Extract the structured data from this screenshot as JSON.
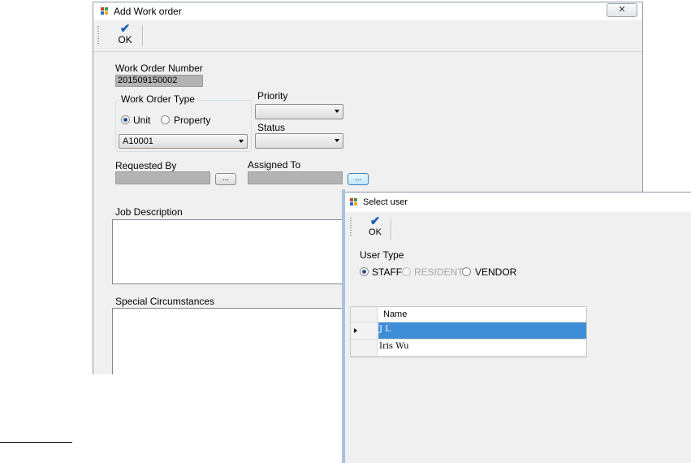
{
  "main_window": {
    "title": "Add Work order",
    "close_glyph": "✕",
    "toolbar": {
      "ok_label": "OK",
      "ok_icon": "check-icon"
    },
    "work_order_number": {
      "label": "Work Order Number",
      "value": "201509150002"
    },
    "work_order_type": {
      "label": "Work Order Type",
      "options": [
        {
          "label": "Unit",
          "selected": true
        },
        {
          "label": "Property",
          "selected": false
        }
      ],
      "unit_value": "A10001"
    },
    "priority": {
      "label": "Priority",
      "value": ""
    },
    "status": {
      "label": "Status",
      "value": ""
    },
    "requested_by": {
      "label": "Requested By",
      "value": "",
      "browse_label": "..."
    },
    "assigned_to": {
      "label": "Assigned To",
      "value": "",
      "browse_label": "..."
    },
    "job_description": {
      "label": "Job Description"
    },
    "special_circumstances": {
      "label": "Special Circumstances"
    }
  },
  "select_user_window": {
    "title": "Select user",
    "toolbar": {
      "ok_label": "OK",
      "ok_icon": "check-icon"
    },
    "user_type": {
      "label": "User Type",
      "options": [
        {
          "label": "STAFF",
          "selected": true,
          "enabled": true
        },
        {
          "label": "RESIDENT",
          "selected": false,
          "enabled": false
        },
        {
          "label": "VENDOR",
          "selected": false,
          "enabled": true
        }
      ]
    },
    "grid": {
      "columns": [
        "Name"
      ],
      "rows": [
        {
          "name": "J L",
          "selected": true
        },
        {
          "name": "Iris Wu",
          "selected": false
        }
      ]
    }
  },
  "colors": {
    "accent": "#1c5fb5",
    "selection": "#3d8ed6",
    "readonly_field": "#b3b3b3"
  }
}
